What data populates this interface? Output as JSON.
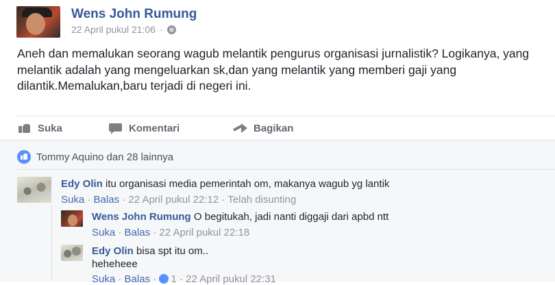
{
  "post": {
    "author": "Wens John Rumung",
    "timestamp": "22 April pukul 21:06",
    "separator": "·",
    "privacy_icon": "globe-icon",
    "text": "Aneh dan memalukan seorang wagub melantik pengurus organisasi jurnalistik? Logikanya, yang melantik adalah yang mengeluarkan sk,dan yang melantik yang memberi gaji yang dilantik.Memalukan,baru terjadi di negeri ini."
  },
  "actions": {
    "like": "Suka",
    "comment": "Komentari",
    "share": "Bagikan"
  },
  "likes": {
    "text": "Tommy Aquino dan 28 lainnya"
  },
  "comments": [
    {
      "author": "Edy Olin",
      "text": "itu organisasi media pemerintah om, makanya wagub yg lantik",
      "like": "Suka",
      "reply": "Balas",
      "sep": "·",
      "time": "22 April pukul 22:12",
      "edited": "Telah disunting",
      "replies": [
        {
          "author": "Wens John Rumung",
          "text": "O begitukah, jadi nanti diggaji dari apbd ntt",
          "like": "Suka",
          "reply": "Balas",
          "sep": "·",
          "time": "22 April pukul 22:18"
        },
        {
          "author": "Edy Olin",
          "text": "bisa spt itu om..",
          "text2": "heheheee",
          "like": "Suka",
          "reply": "Balas",
          "sep": "·",
          "like_count": "1",
          "time": "22 April pukul 22:31"
        }
      ]
    }
  ],
  "colors": {
    "name_link": "#365899",
    "meta_gray": "#90949c",
    "comments_bg": "#f6f7f9",
    "like_blue": "#5890ff"
  }
}
